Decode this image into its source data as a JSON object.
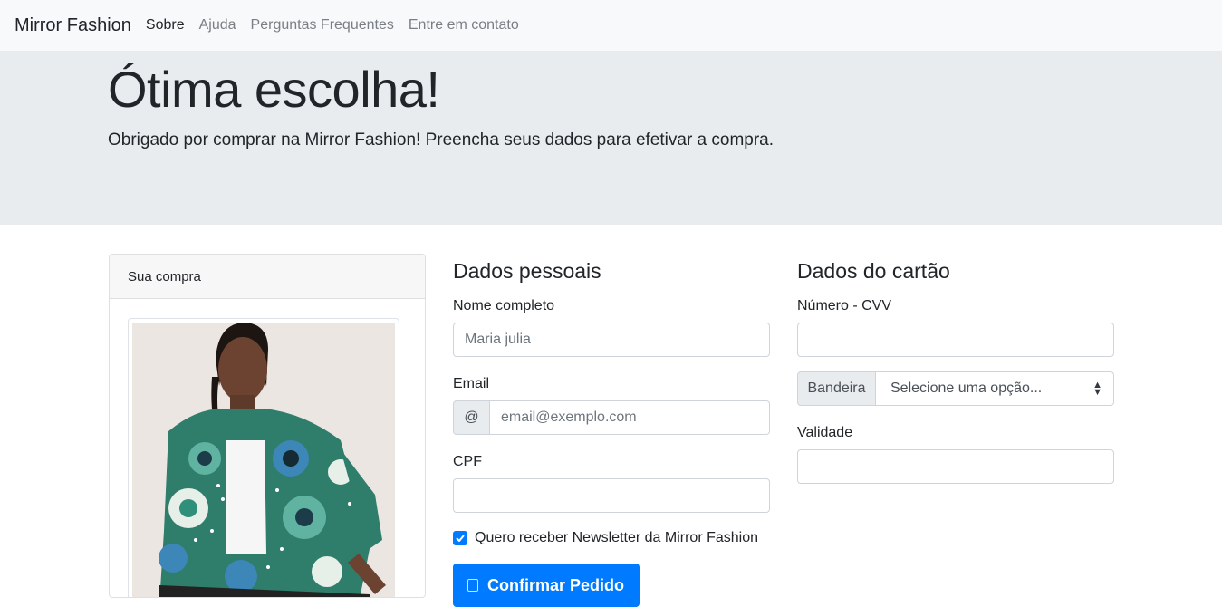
{
  "navbar": {
    "brand": "Mirror Fashion",
    "links": [
      {
        "label": "Sobre",
        "active": true
      },
      {
        "label": "Ajuda",
        "active": false
      },
      {
        "label": "Perguntas Frequentes",
        "active": false
      },
      {
        "label": "Entre em contato",
        "active": false
      }
    ]
  },
  "hero": {
    "title": "Ótima escolha!",
    "lead": "Obrigado por comprar na Mirror Fashion! Preencha seus dados para efetivar a compra."
  },
  "purchase_card": {
    "header": "Sua compra"
  },
  "personal": {
    "title": "Dados pessoais",
    "name_label": "Nome completo",
    "name_placeholder": "Maria julia",
    "email_label": "Email",
    "email_addon": "@",
    "email_placeholder": "email@exemplo.com",
    "cpf_label": "CPF",
    "cpf_value": "",
    "newsletter_label": "Quero receber Newsletter da Mirror Fashion",
    "newsletter_checked": true,
    "submit_label": "Confirmar Pedido"
  },
  "card_data": {
    "title": "Dados do cartão",
    "number_label": "Número - CVV",
    "number_value": "",
    "brand_addon": "Bandeira",
    "brand_selected": "Selecione uma opção...",
    "validity_label": "Validade",
    "validity_value": ""
  },
  "colors": {
    "primary": "#007bff",
    "navbar_bg": "#f8f9fa",
    "jumbotron_bg": "#e9ecef"
  }
}
